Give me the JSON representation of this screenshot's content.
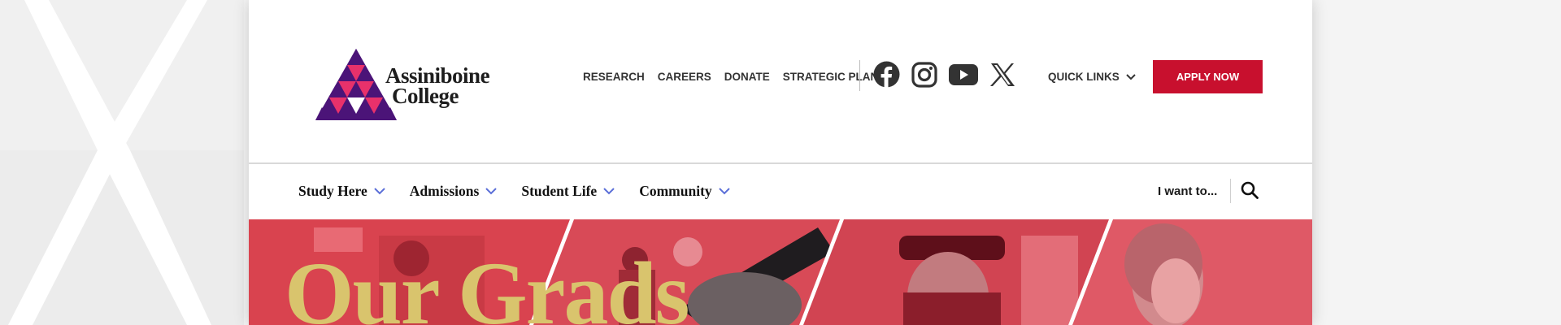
{
  "brand": {
    "name_line1": "Assiniboine",
    "name_line2": "College",
    "colors": {
      "purple": "#4b1478",
      "crimson": "#c8102e",
      "pink": "#e8316b",
      "gold": "#d9c46d"
    }
  },
  "utility_nav": [
    {
      "label": "RESEARCH"
    },
    {
      "label": "CAREERS"
    },
    {
      "label": "DONATE"
    },
    {
      "label": "STRATEGIC PLAN"
    }
  ],
  "social": [
    {
      "icon": "facebook-icon"
    },
    {
      "icon": "instagram-icon"
    },
    {
      "icon": "youtube-icon"
    },
    {
      "icon": "x-icon"
    }
  ],
  "quick_links": {
    "label": "QUICK LINKS",
    "icon": "chevron-down-icon"
  },
  "apply_button": {
    "label": "APPLY NOW"
  },
  "main_nav": [
    {
      "label": "Study Here"
    },
    {
      "label": "Admissions"
    },
    {
      "label": "Student Life"
    },
    {
      "label": "Community"
    }
  ],
  "i_want_to": {
    "label": "I want to..."
  },
  "search": {
    "icon": "search-icon"
  },
  "hero": {
    "title": "Our Grads"
  }
}
